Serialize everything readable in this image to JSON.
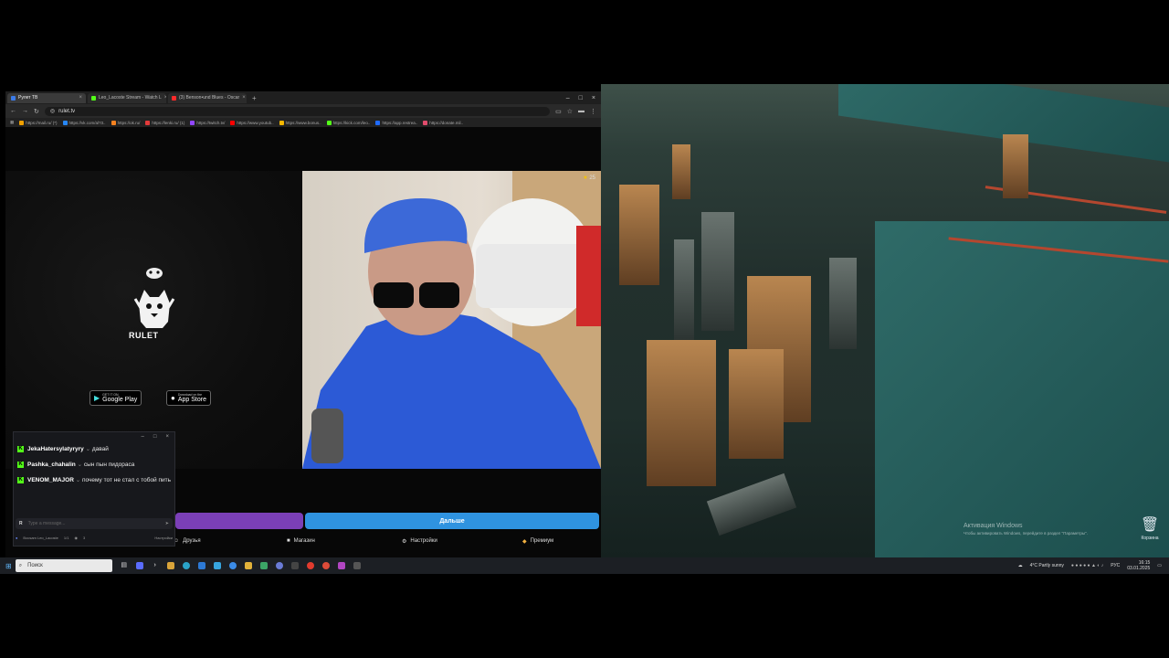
{
  "browser": {
    "tabs": [
      {
        "label": "Рулет ТВ",
        "color": "#3b7be8",
        "active": true
      },
      {
        "label": "Leo_Lacoste Stream - Watch L",
        "color": "#53fc18",
        "active": false
      },
      {
        "label": "(3) Benson•und Blues - Oscar",
        "color": "#ff2a2a",
        "active": false
      }
    ],
    "new_tab": "+",
    "url": "rulet.tv",
    "bookmarks": [
      {
        "label": "https://mail.ru/ (*)",
        "color": "#f0a000"
      },
      {
        "label": "https://vk.com/al?3..",
        "color": "#2787f5"
      },
      {
        "label": "https://ok.ru/",
        "color": "#f58220"
      },
      {
        "label": "https://lenki.ru/ (1)",
        "color": "#e23a3a"
      },
      {
        "label": "https://twitch.tv/",
        "color": "#9146ff"
      },
      {
        "label": "https://www.youtub..",
        "color": "#ff0000"
      },
      {
        "label": "https://www.bonus..",
        "color": "#f5b700"
      },
      {
        "label": "https://kick.com/leo..",
        "color": "#53fc18"
      },
      {
        "label": "https://app.restrea..",
        "color": "#1f6bff"
      },
      {
        "label": "https://donate.mil..",
        "color": "#e14c6c"
      }
    ]
  },
  "page": {
    "brand": "RULET",
    "store_google_small": "GET IT ON",
    "store_google": "Google Play",
    "store_apple_small": "Download on the",
    "store_apple": "App Store",
    "likes": "25",
    "next_label": "Дальше",
    "nav": [
      {
        "label": "Друзья",
        "icon": "friends-icon"
      },
      {
        "label": "Магазин",
        "icon": "shop-icon"
      },
      {
        "label": "Настройки",
        "icon": "settings-icon"
      },
      {
        "label": "Премиум",
        "icon": "premium-icon"
      }
    ]
  },
  "chat": {
    "messages": [
      {
        "user": "JekaHatersylatyryry",
        "text": "давай"
      },
      {
        "user": "Pashka_chahalin",
        "text": "сын пын пидораса"
      },
      {
        "user": "VENOM_MAJOR",
        "text": "почему тот не стал с тобой пить"
      }
    ],
    "input_placeholder": "Type a message...",
    "footer_user": "Bocsam Leo_Lacoste",
    "footer_stats": "1/1",
    "footer_viewers": "3",
    "footer_right": "Настройки"
  },
  "desktop": {
    "activation_title": "Активация Windows",
    "activation_text": "Чтобы активировать Windows, перейдите в раздел \"Параметры\".",
    "recycle_bin": "Корзина"
  },
  "taskbar": {
    "search_placeholder": "Поиск",
    "weather": "4°C  Partly sunny",
    "lang": "РУС",
    "time": "16:15",
    "date": "03.01.2025"
  },
  "colors": {
    "kick_green": "#53fc18",
    "next_blue": "#2f93e0",
    "purple": "#7b3fb7"
  }
}
